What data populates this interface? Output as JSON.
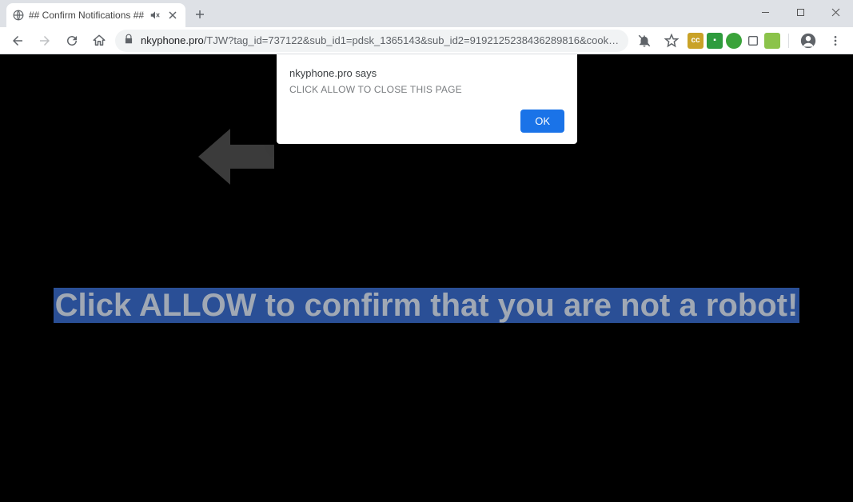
{
  "window": {
    "tab": {
      "title": "## Confirm Notifications ##"
    }
  },
  "toolbar": {
    "url_domain": "nkyphone.pro",
    "url_path": "/TJW?tag_id=737122&sub_id1=pdsk_1365143&sub_id2=9192125238436289816&cookie_id=e6d6b487-3d77-..."
  },
  "alert": {
    "title": "nkyphone.pro says",
    "message": "CLICK ALLOW TO CLOSE THIS PAGE",
    "ok_label": "OK"
  },
  "page": {
    "banner_text": "Click ALLOW to confirm that you are not a robot!"
  }
}
